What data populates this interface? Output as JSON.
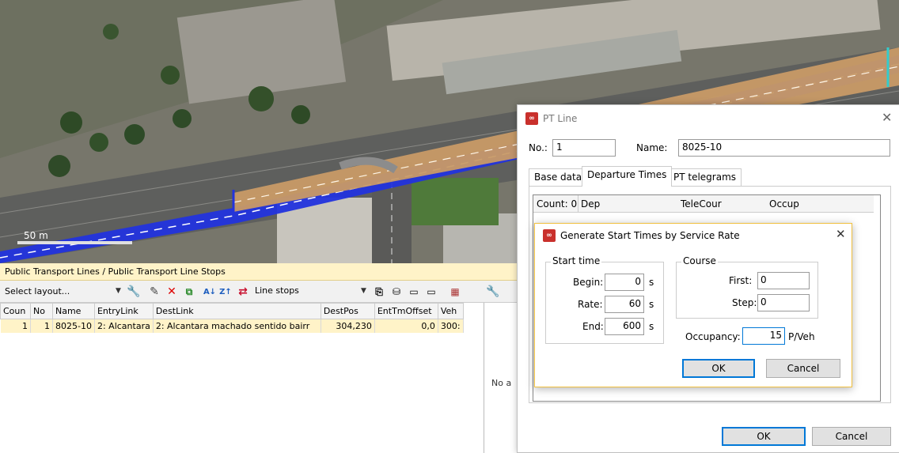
{
  "map": {
    "scale_label": "50 m"
  },
  "list": {
    "title": "Public Transport Lines / Public Transport Line Stops",
    "layout_select": "Select layout...",
    "line_stops_label": "Line stops",
    "columns": [
      "Coun",
      "No",
      "Name",
      "EntryLink",
      "DestLink",
      "DestPos",
      "EntTmOffset",
      "Veh"
    ],
    "rows": [
      {
        "count": "1",
        "no": "1",
        "name": "8025-10",
        "entry_link": "2: Alcantara",
        "dest_link": "2: Alcantara machado sentido bairr",
        "dest_pos": "304,230",
        "ent_tm_offset": "0,0",
        "veh": "300:"
      }
    ],
    "right_pane_text": "No a"
  },
  "pt_dialog": {
    "title": "PT Line",
    "no_label": "No.:",
    "no_value": "1",
    "name_label": "Name:",
    "name_value": "8025-10",
    "tabs": [
      "Base data",
      "Departure Times",
      "PT telegrams"
    ],
    "columns": [
      "Count: 0",
      "Dep",
      "TeleCour",
      "Occup"
    ],
    "ok_label": "OK",
    "cancel_label": "Cancel"
  },
  "gen_dialog": {
    "title": "Generate Start Times by Service Rate",
    "start_time_group": "Start time",
    "begin_label": "Begin:",
    "begin_value": "0",
    "rate_label": "Rate:",
    "rate_value": "60",
    "end_label": "End:",
    "end_value": "600",
    "unit_s": "s",
    "course_group": "Course",
    "first_label": "First:",
    "first_value": "0",
    "step_label": "Step:",
    "step_value": "0",
    "occupancy_label": "Occupancy:",
    "occupancy_value": "15",
    "occupancy_unit": "P/Veh",
    "ok_label": "OK",
    "cancel_label": "Cancel"
  },
  "colors": {
    "link_blue": "#2233dd",
    "link_orange": "#c89a66",
    "list_highlight": "#fff3c8",
    "app_icon_red": "#c9302c"
  }
}
